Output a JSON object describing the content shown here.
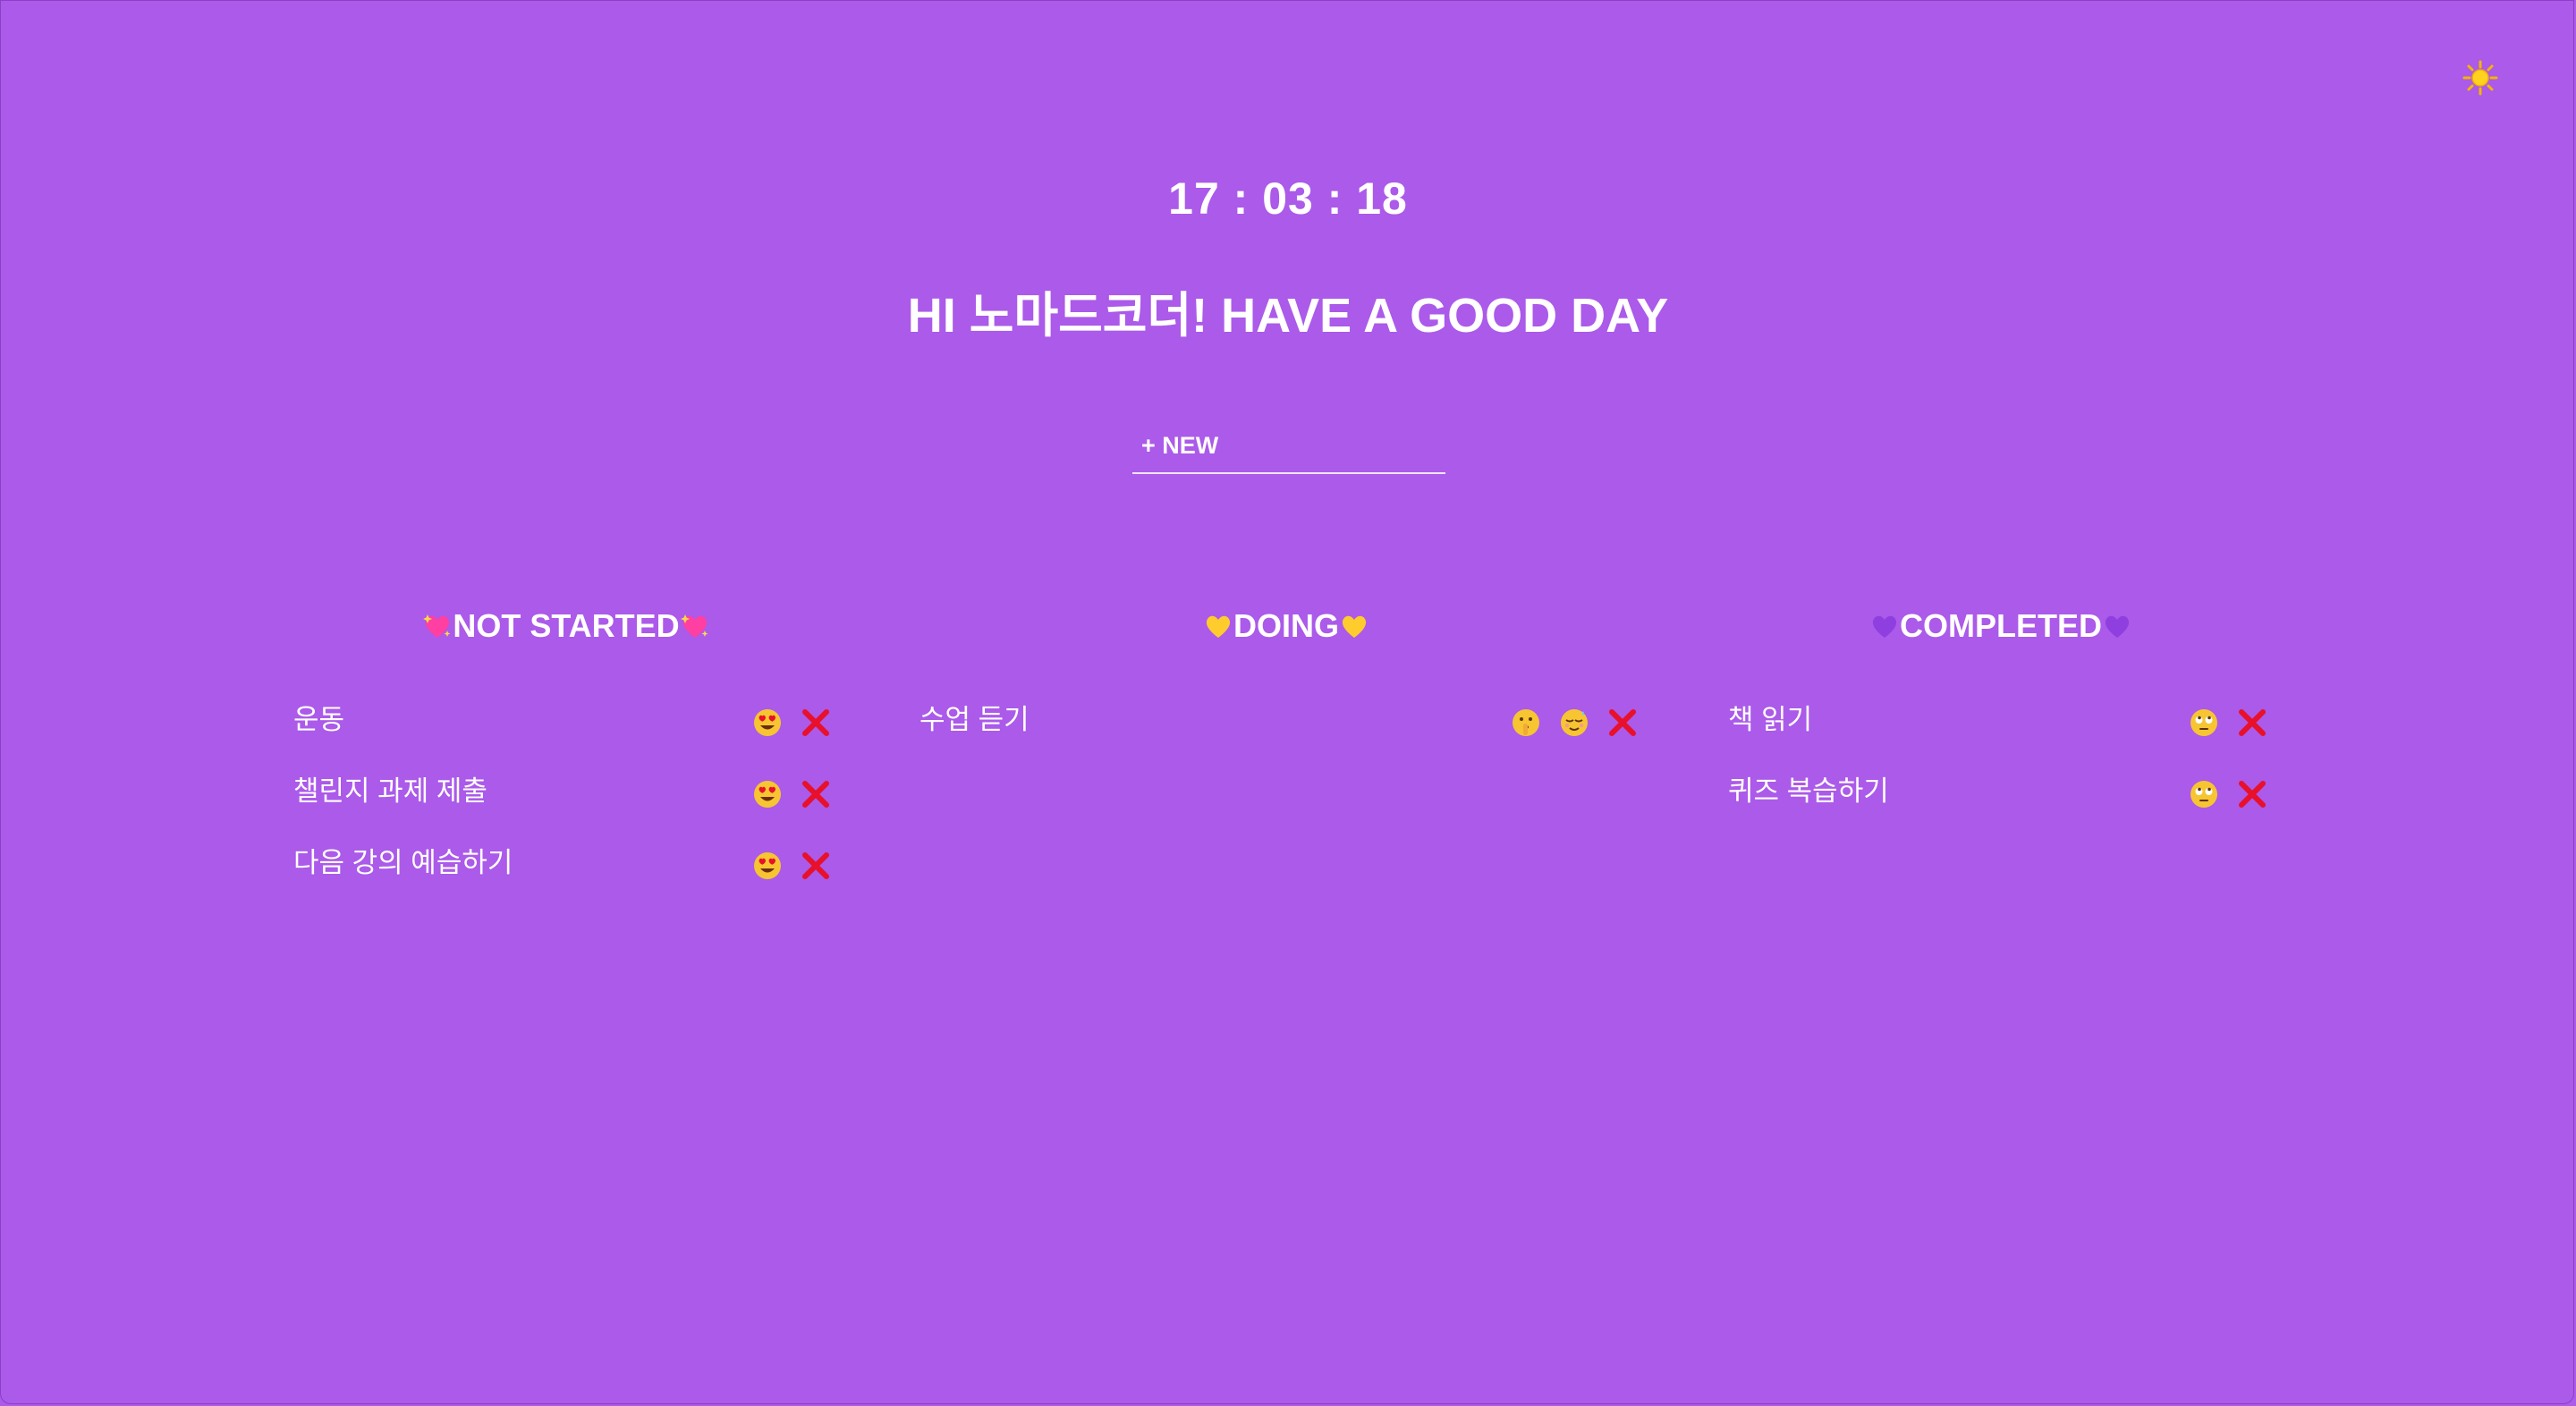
{
  "clock": "17 : 03 : 18",
  "greeting": "HI 노마드코더! HAVE A GOOD DAY",
  "new_todo": {
    "placeholder": "+ NEW",
    "value": ""
  },
  "theme_toggle_icon": "sun-icon",
  "colors": {
    "background": "#ab5ae9",
    "text": "#ffffff",
    "delete": "#e8102a",
    "emoji_face": "#f7c531"
  },
  "columns": [
    {
      "id": "not-started",
      "title": "NOT STARTED",
      "heart_icon": "sparkling-heart-icon",
      "heart_color": "#ff3fa2",
      "tasks": [
        {
          "text": "운동",
          "actions": [
            "heart-eyes-icon",
            "cross-mark-icon"
          ]
        },
        {
          "text": "챌린지 과제 제출",
          "actions": [
            "heart-eyes-icon",
            "cross-mark-icon"
          ]
        },
        {
          "text": "다음 강의 예습하기",
          "actions": [
            "heart-eyes-icon",
            "cross-mark-icon"
          ]
        }
      ]
    },
    {
      "id": "doing",
      "title": "DOING",
      "heart_icon": "yellow-heart-icon",
      "heart_color": "#ffcc2e",
      "tasks": [
        {
          "text": "수업 듣기",
          "actions": [
            "shushing-face-icon",
            "relieved-face-icon",
            "cross-mark-icon"
          ]
        }
      ]
    },
    {
      "id": "completed",
      "title": "COMPLETED",
      "heart_icon": "purple-heart-icon",
      "heart_color": "#8f3fe0",
      "tasks": [
        {
          "text": "책 읽기",
          "actions": [
            "face-with-rolling-eyes-icon",
            "cross-mark-icon"
          ]
        },
        {
          "text": "퀴즈 복습하기",
          "actions": [
            "face-with-rolling-eyes-icon",
            "cross-mark-icon"
          ]
        }
      ]
    }
  ]
}
